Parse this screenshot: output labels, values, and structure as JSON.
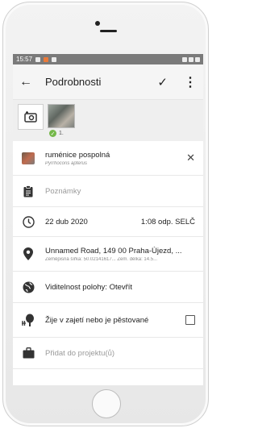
{
  "status_bar": {
    "time": "15:57"
  },
  "app_bar": {
    "back_icon": "arrow-left-icon",
    "title": "Podrobnosti",
    "check_icon": "check-icon",
    "more_icon": "more-vertical-icon"
  },
  "photos": {
    "add_icon": "add-photo-icon",
    "count_label": "1."
  },
  "species": {
    "common_name": "ruménice pospolná",
    "scientific_name": "Pyrrhocoris apterus",
    "clear_icon": "close-icon"
  },
  "notes": {
    "placeholder": "Poznámky",
    "icon": "clipboard-icon"
  },
  "date": {
    "date_label": "22 dub 2020",
    "time_label": "1:08 odp. SELČ",
    "icon": "clock-icon"
  },
  "location": {
    "address": "Unnamed Road, 149 00 Praha-Újezd, ...",
    "coords": "Zeměpisná šířka: 50.02141617...   Zem. délka: 14.5...",
    "icon": "map-pin-icon"
  },
  "geoprivacy": {
    "label": "Viditelnost polohy: Otevřít",
    "icon": "globe-icon"
  },
  "captive": {
    "label": "Žije v zajetí nebo je pěstované",
    "checked": false,
    "icon": "captive-plant-icon"
  },
  "project": {
    "placeholder": "Přidat do projektu(ů)",
    "icon": "briefcase-icon"
  }
}
